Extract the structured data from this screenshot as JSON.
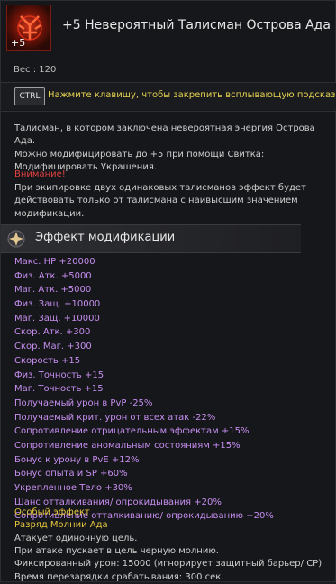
{
  "item": {
    "enchant_badge": "+5",
    "title": "+5 Невероятный Талисман Острова Ада",
    "icon": "talisman-icon",
    "weight": "Вес : 120"
  },
  "hint": {
    "key": "CTRL",
    "text": "Нажмите клавишу, чтобы закрепить всплывающую подсказку."
  },
  "description": [
    "Талисман, в котором заключена невероятная энергия Острова Ада.",
    "Можно модифицировать до +5 при помощи Свитка:",
    "Модифицировать Украшения."
  ],
  "warning": {
    "title": "Внимание!",
    "lines": [
      "При экипировке двух одинаковых талисманов эффект будет",
      "действовать только от талисмана с наивысшим значением",
      "модификации."
    ]
  },
  "modification": {
    "title": "Эффект модификации",
    "stats": [
      "Макс. HP +20000",
      "Физ. Атк. +5000",
      "Маг. Атк. +5000",
      "Физ. Защ. +10000",
      "Маг. Защ. +10000",
      "Скор. Атк. +300",
      "Скор. Маг. +300",
      "Скорость +15",
      "Физ. Точность +15",
      "Маг. Точность +15",
      "Получаемый урон в PvP -25%",
      "Получаемый крит. урон от всех атак -22%",
      "Сопротивление отрицательным эффектам +15%",
      "Сопротивление аномальным состояниям +15%",
      "Бонус к урону в PvE +12%",
      "Бонус опыта и SP +60%",
      "Укрепленное Тело +30%",
      "Шанс отталкивания/ опрокидывания +20%",
      "Сопротивление отталкиванию/ опрокидыванию +20%"
    ]
  },
  "special": {
    "label": "Особый эффект",
    "name": "Разряд Молнии Ада",
    "lines": [
      "Атакует одиночную цель.",
      "При атаке пускает в цель черную молнию.",
      "Фиксированный урон: 15000 (игнорирует защитный барьер/ СР)",
      "Время перезарядки срабатывания: 300 сек."
    ]
  }
}
